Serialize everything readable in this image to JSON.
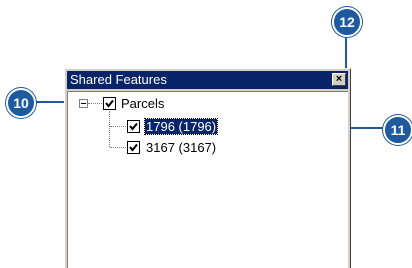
{
  "window": {
    "title": "Shared Features",
    "close_label": "×"
  },
  "tree": {
    "root": {
      "label": "Parcels",
      "expanded": true,
      "checked": true
    },
    "children": [
      {
        "label": "1796 (1796)",
        "checked": true,
        "selected": true
      },
      {
        "label": "3167 (3167)",
        "checked": true,
        "selected": false
      }
    ]
  },
  "callouts": [
    "10",
    "11",
    "12"
  ],
  "colors": {
    "title_bar": "#0a246a",
    "callout": "#1f5a9e",
    "selection": "#0a246a"
  }
}
